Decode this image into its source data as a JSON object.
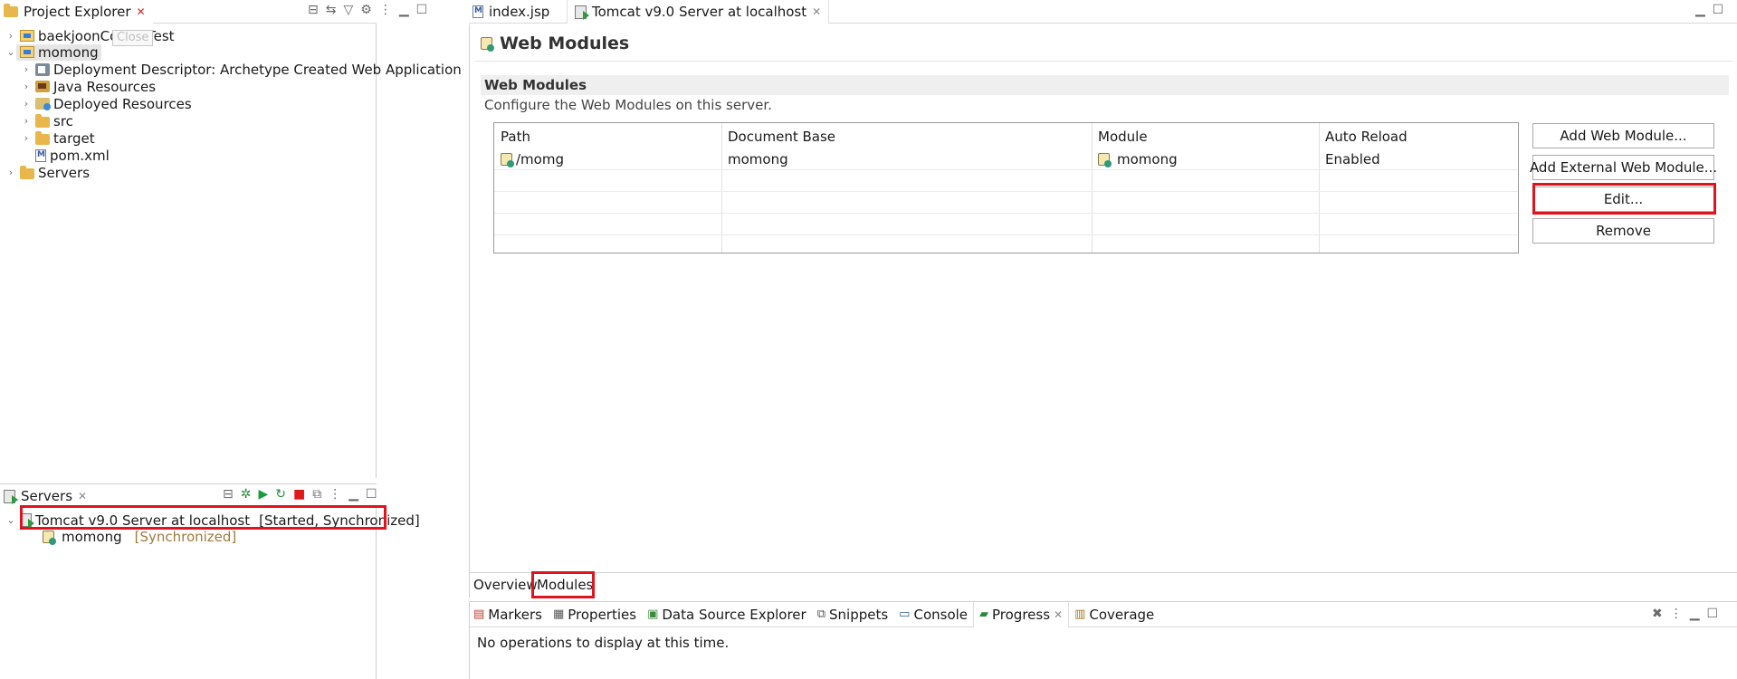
{
  "project_explorer": {
    "title": "Project Explorer",
    "tooltip": "Close",
    "tree": [
      {
        "label": "baekjoonCodingTest",
        "icon": "project-icon",
        "expanded": false
      },
      {
        "label": "momong",
        "icon": "web-project-icon",
        "expanded": true
      },
      {
        "label": "Deployment Descriptor: Archetype Created Web Application",
        "icon": "deployment-descriptor-icon",
        "expanded": false
      },
      {
        "label": "Java Resources",
        "icon": "java-resources-icon",
        "expanded": false
      },
      {
        "label": "Deployed Resources",
        "icon": "deployed-resources-icon",
        "expanded": false
      },
      {
        "label": "src",
        "icon": "folder-icon",
        "expanded": false
      },
      {
        "label": "target",
        "icon": "folder-icon",
        "expanded": false
      },
      {
        "label": "pom.xml",
        "icon": "maven-file-icon",
        "expanded": null
      },
      {
        "label": "Servers",
        "icon": "folder-icon",
        "expanded": false
      }
    ]
  },
  "servers_view": {
    "title": "Servers",
    "server_name": "Tomcat v9.0 Server at localhost",
    "server_state": "[Started, Synchronized]",
    "module_name": "momong",
    "module_state": "[Synchronized]"
  },
  "editor": {
    "tabs": [
      {
        "label": "index.jsp",
        "active": false
      },
      {
        "label": "Tomcat v9.0 Server at localhost",
        "active": true
      }
    ],
    "page_title": "Web Modules",
    "section_title": "Web Modules",
    "section_description": "Configure the Web Modules on this server.",
    "table": {
      "headers": [
        "Path",
        "Document Base",
        "Module",
        "Auto Reload"
      ],
      "rows": [
        [
          "/momg",
          "momong",
          "momong",
          "Enabled"
        ]
      ]
    },
    "buttons": {
      "add_web_module": "Add Web Module...",
      "add_external_web_module": "Add External Web Module...",
      "edit": "Edit...",
      "remove": "Remove"
    },
    "bottom_tabs": [
      "Overview",
      "Modules"
    ]
  },
  "bottom_panel": {
    "tabs": [
      "Markers",
      "Properties",
      "Data Source Explorer",
      "Snippets",
      "Console",
      "Progress",
      "Coverage"
    ],
    "active_tab": "Progress",
    "message": "No operations to display at this time."
  },
  "colors": {
    "highlight_red": "#e0141e",
    "selection_bg": "#e6e6e6",
    "synchronized_text": "#a07a3a"
  }
}
